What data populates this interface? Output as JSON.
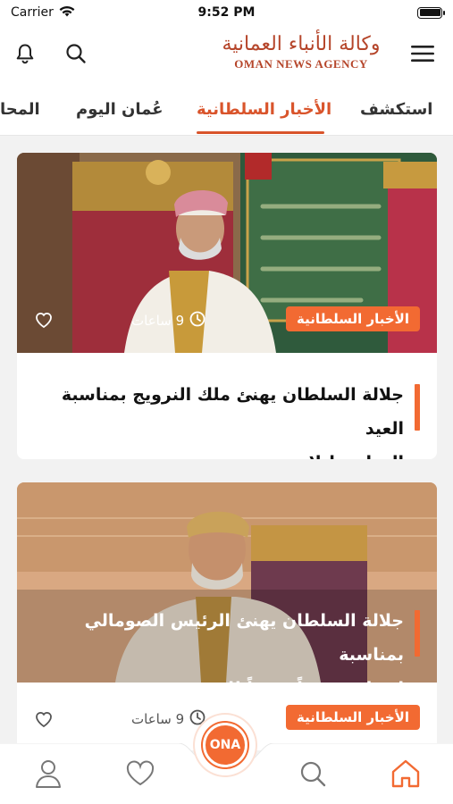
{
  "status_bar": {
    "carrier": "Carrier",
    "time": "9:52 PM",
    "battery_level": 1.0
  },
  "header": {
    "logo_ar": "وكالة الأنباء العمانية",
    "logo_en": "OMAN NEWS AGENCY",
    "icons": [
      "bell-icon",
      "search-icon",
      "menu-icon"
    ]
  },
  "tabs": [
    {
      "label": "استكشف",
      "active": false
    },
    {
      "label": "الأخبار السلطانية",
      "active": true
    },
    {
      "label": "عُمان اليوم",
      "active": false
    },
    {
      "label": "المحا",
      "active": false
    }
  ],
  "articles": [
    {
      "category": "الأخبار السلطانية",
      "time": "9 ساعات",
      "title_line1": "جلالة السلطان يهنئ ملك النرويج بمناسبة العيد",
      "title_line2": "الوطني لبلاده"
    },
    {
      "category": "الأخبار السلطانية",
      "time": "9 ساعات",
      "title_line1": "جلالة السلطان يهنئ الرئيس الصومالي بمناسبة",
      "title_line2": "انتخابه رئيساً جديداً للجمهورية"
    }
  ],
  "bottom_nav": {
    "center_label": "ONA",
    "items": [
      "home-icon",
      "search-icon",
      "heart-icon",
      "user-icon"
    ],
    "active": "home-icon"
  },
  "colors": {
    "accent": "#f26a32",
    "brand": "#b5452a",
    "tab_active": "#d9542b"
  }
}
